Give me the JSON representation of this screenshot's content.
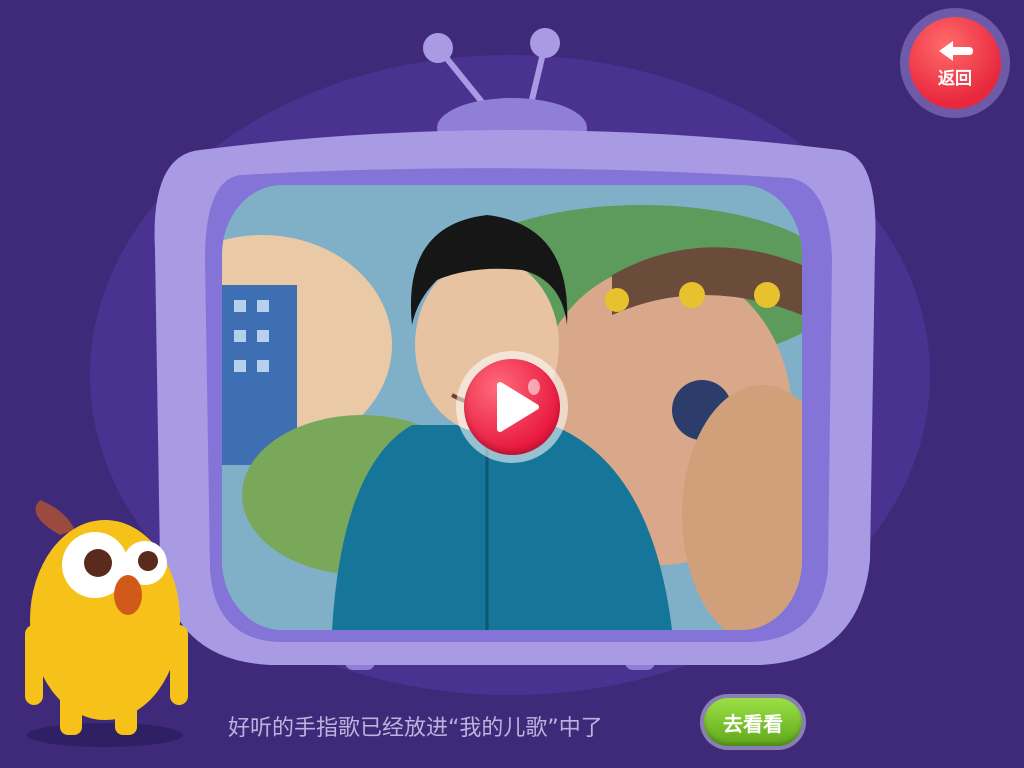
{
  "back_button": {
    "label": "返回",
    "icon": "back-arrow-icon"
  },
  "video": {
    "play_icon": "play-icon"
  },
  "message": {
    "text": "好听的手指歌已经放进“我的儿歌”中了"
  },
  "go_button": {
    "label": "去看看"
  },
  "colors": {
    "background": "#3f2a7a",
    "tv_body": "#a99be3",
    "back_button": "#e8283d",
    "play_button": "#e8193f",
    "go_button": "#6cb924",
    "message_text": "#bcb2dd"
  }
}
